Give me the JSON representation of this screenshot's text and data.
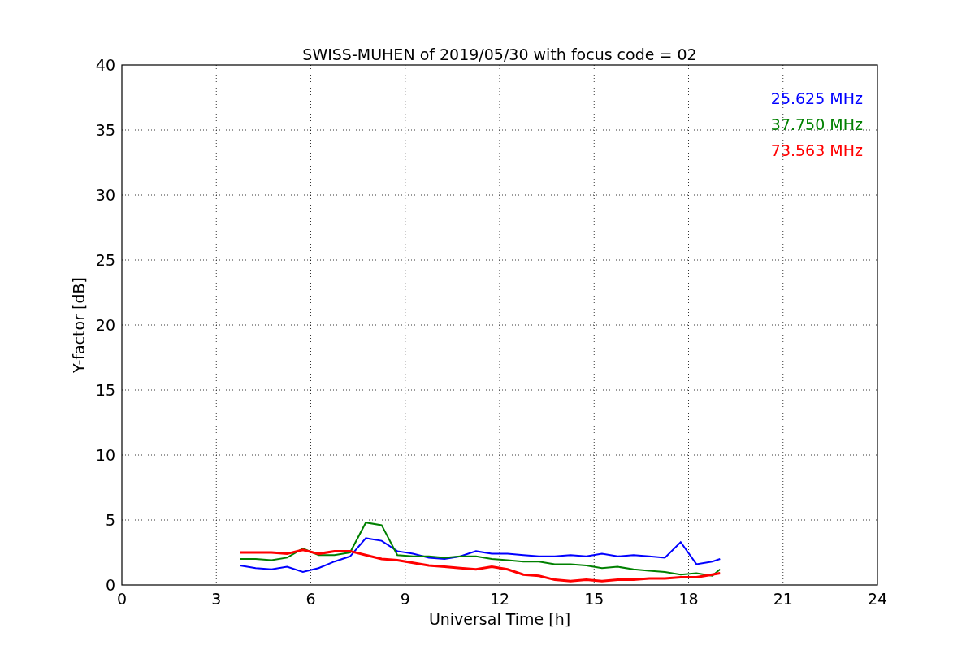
{
  "figure": {
    "chart_data": {
      "type": "line",
      "title": "SWISS-MUHEN of 2019/05/30 with focus code = 02",
      "xlabel": "Universal Time [h]",
      "ylabel": "Y-factor [dB]",
      "x": [
        3.75,
        4.25,
        4.75,
        5.25,
        5.75,
        6.25,
        6.75,
        7.25,
        7.75,
        8.25,
        8.75,
        9.25,
        9.75,
        10.25,
        10.75,
        11.25,
        11.75,
        12.25,
        12.75,
        13.25,
        13.75,
        14.25,
        14.75,
        15.25,
        15.75,
        16.25,
        16.75,
        17.25,
        17.75,
        18.25,
        18.75,
        19
      ],
      "series": [
        {
          "name": "25.625 MHz",
          "color": "#0000ff",
          "values": [
            1.5,
            1.3,
            1.2,
            1.4,
            1.0,
            1.3,
            1.8,
            2.2,
            3.6,
            3.4,
            2.6,
            2.4,
            2.1,
            2.0,
            2.2,
            2.6,
            2.4,
            2.4,
            2.3,
            2.2,
            2.2,
            2.3,
            2.2,
            2.4,
            2.2,
            2.3,
            2.2,
            2.1,
            3.3,
            1.6,
            1.8,
            2.0
          ]
        },
        {
          "name": "37.750 MHz",
          "color": "#008000",
          "values": [
            2.0,
            2.0,
            1.9,
            2.1,
            2.8,
            2.3,
            2.3,
            2.5,
            4.8,
            4.6,
            2.3,
            2.2,
            2.2,
            2.1,
            2.2,
            2.2,
            2.0,
            1.9,
            1.8,
            1.8,
            1.6,
            1.6,
            1.5,
            1.3,
            1.4,
            1.2,
            1.1,
            1.0,
            0.8,
            0.9,
            0.7,
            1.2
          ]
        },
        {
          "name": "73.563 MHz",
          "color": "#ff0000",
          "values": [
            2.5,
            2.5,
            2.5,
            2.4,
            2.7,
            2.4,
            2.6,
            2.6,
            2.3,
            2.0,
            1.9,
            1.7,
            1.5,
            1.4,
            1.3,
            1.2,
            1.4,
            1.2,
            0.8,
            0.7,
            0.4,
            0.3,
            0.4,
            0.3,
            0.4,
            0.4,
            0.5,
            0.5,
            0.6,
            0.6,
            0.8,
            0.9
          ]
        }
      ],
      "grid": true,
      "xlim": [
        0,
        24
      ],
      "ylim": [
        0,
        40
      ],
      "xticks": [
        0,
        3,
        6,
        9,
        12,
        15,
        18,
        21,
        24
      ],
      "yticks": [
        0,
        5,
        10,
        15,
        20,
        25,
        30,
        35,
        40
      ]
    }
  }
}
